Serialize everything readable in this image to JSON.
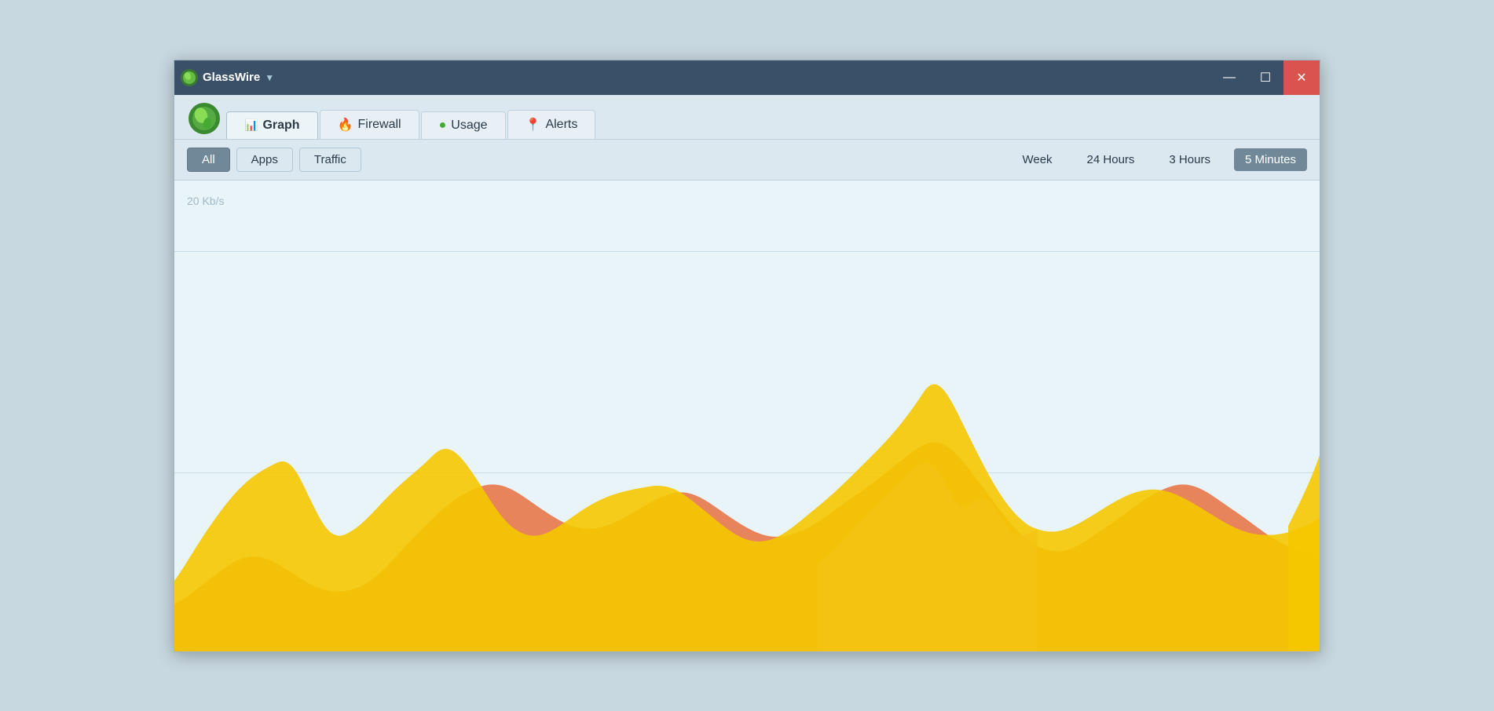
{
  "titlebar": {
    "app_name": "GlassWire",
    "dropdown_symbol": "▼",
    "minimize": "—",
    "maximize": "☐",
    "close": "✕"
  },
  "nav": {
    "tabs": [
      {
        "id": "graph",
        "label": "Graph",
        "icon": "graph-icon",
        "active": true
      },
      {
        "id": "firewall",
        "label": "Firewall",
        "icon": "firewall-icon",
        "active": false
      },
      {
        "id": "usage",
        "label": "Usage",
        "icon": "usage-icon",
        "active": false
      },
      {
        "id": "alerts",
        "label": "Alerts",
        "icon": "alerts-icon",
        "active": false
      }
    ]
  },
  "filters": {
    "left": [
      {
        "id": "all",
        "label": "All",
        "active": true
      },
      {
        "id": "apps",
        "label": "Apps",
        "active": false
      },
      {
        "id": "traffic",
        "label": "Traffic",
        "active": false
      }
    ],
    "right": [
      {
        "id": "week",
        "label": "Week",
        "active": false
      },
      {
        "id": "24h",
        "label": "24 Hours",
        "active": false
      },
      {
        "id": "3h",
        "label": "3 Hours",
        "active": false
      },
      {
        "id": "5m",
        "label": "5 Minutes",
        "active": true
      }
    ]
  },
  "chart": {
    "y_label": "20 Kb/s",
    "colors": {
      "yellow": "#f5c800",
      "orange": "#e87040",
      "pink": "#e890c0",
      "bg": "#e8f4f8",
      "gridline": "#c8dce8"
    }
  }
}
